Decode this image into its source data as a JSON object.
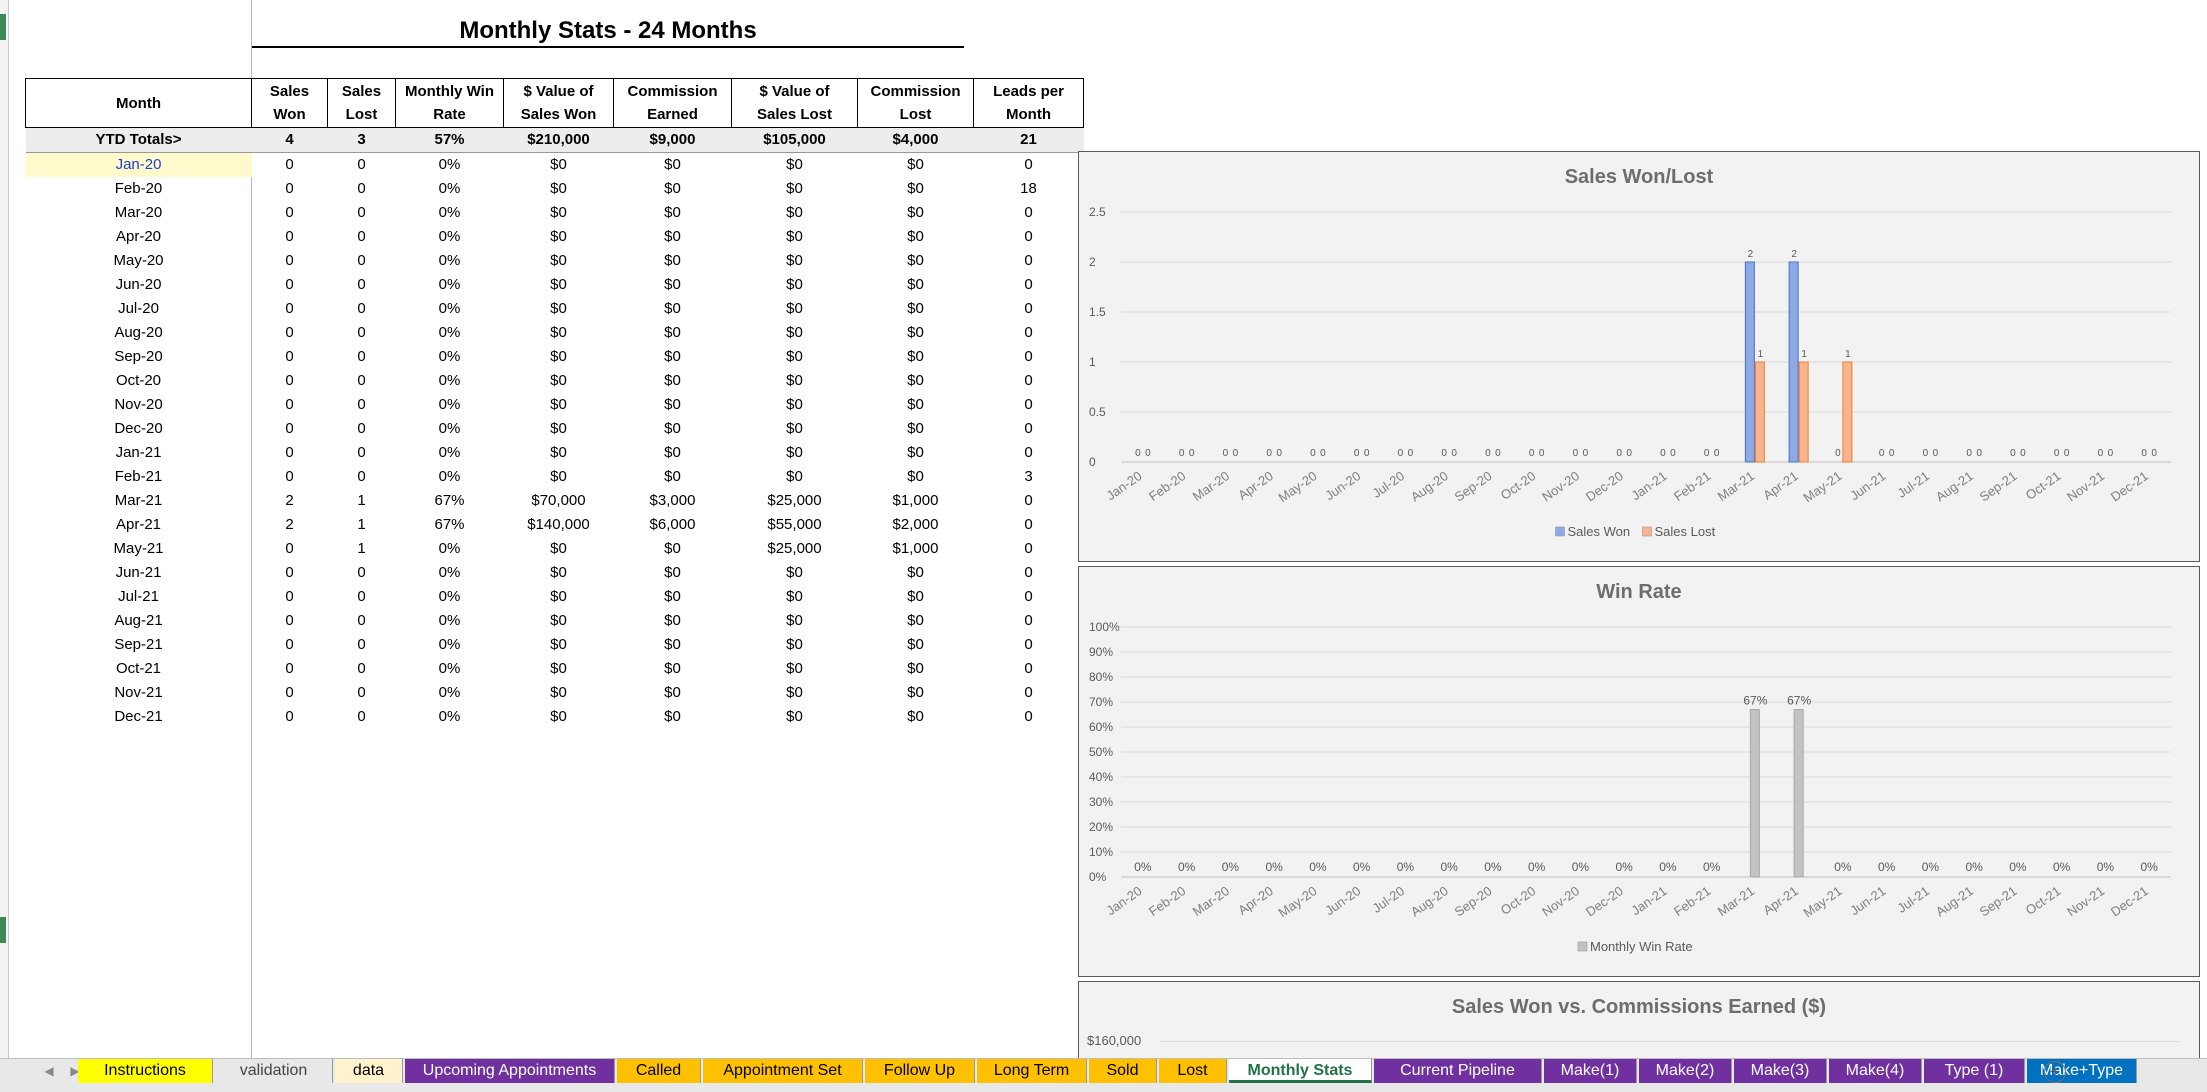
{
  "title": "Monthly Stats - 24 Months",
  "headers": [
    [
      "Month"
    ],
    [
      "Sales",
      "Won"
    ],
    [
      "Sales",
      "Lost"
    ],
    [
      "Monthly Win",
      "Rate"
    ],
    [
      "$ Value of",
      "Sales Won"
    ],
    [
      "Commission",
      "Earned"
    ],
    [
      "$ Value of",
      "Sales Lost"
    ],
    [
      "Commission",
      "Lost"
    ],
    [
      "Leads per",
      "Month"
    ]
  ],
  "totals": [
    "YTD Totals>",
    "4",
    "3",
    "57%",
    "$210,000",
    "$9,000",
    "$105,000",
    "$4,000",
    "21"
  ],
  "rows": [
    [
      "Jan-20",
      "0",
      "0",
      "0%",
      "$0",
      "$0",
      "$0",
      "$0",
      "0"
    ],
    [
      "Feb-20",
      "0",
      "0",
      "0%",
      "$0",
      "$0",
      "$0",
      "$0",
      "18"
    ],
    [
      "Mar-20",
      "0",
      "0",
      "0%",
      "$0",
      "$0",
      "$0",
      "$0",
      "0"
    ],
    [
      "Apr-20",
      "0",
      "0",
      "0%",
      "$0",
      "$0",
      "$0",
      "$0",
      "0"
    ],
    [
      "May-20",
      "0",
      "0",
      "0%",
      "$0",
      "$0",
      "$0",
      "$0",
      "0"
    ],
    [
      "Jun-20",
      "0",
      "0",
      "0%",
      "$0",
      "$0",
      "$0",
      "$0",
      "0"
    ],
    [
      "Jul-20",
      "0",
      "0",
      "0%",
      "$0",
      "$0",
      "$0",
      "$0",
      "0"
    ],
    [
      "Aug-20",
      "0",
      "0",
      "0%",
      "$0",
      "$0",
      "$0",
      "$0",
      "0"
    ],
    [
      "Sep-20",
      "0",
      "0",
      "0%",
      "$0",
      "$0",
      "$0",
      "$0",
      "0"
    ],
    [
      "Oct-20",
      "0",
      "0",
      "0%",
      "$0",
      "$0",
      "$0",
      "$0",
      "0"
    ],
    [
      "Nov-20",
      "0",
      "0",
      "0%",
      "$0",
      "$0",
      "$0",
      "$0",
      "0"
    ],
    [
      "Dec-20",
      "0",
      "0",
      "0%",
      "$0",
      "$0",
      "$0",
      "$0",
      "0"
    ],
    [
      "Jan-21",
      "0",
      "0",
      "0%",
      "$0",
      "$0",
      "$0",
      "$0",
      "0"
    ],
    [
      "Feb-21",
      "0",
      "0",
      "0%",
      "$0",
      "$0",
      "$0",
      "$0",
      "3"
    ],
    [
      "Mar-21",
      "2",
      "1",
      "67%",
      "$70,000",
      "$3,000",
      "$25,000",
      "$1,000",
      "0"
    ],
    [
      "Apr-21",
      "2",
      "1",
      "67%",
      "$140,000",
      "$6,000",
      "$55,000",
      "$2,000",
      "0"
    ],
    [
      "May-21",
      "0",
      "1",
      "0%",
      "$0",
      "$0",
      "$25,000",
      "$1,000",
      "0"
    ],
    [
      "Jun-21",
      "0",
      "0",
      "0%",
      "$0",
      "$0",
      "$0",
      "$0",
      "0"
    ],
    [
      "Jul-21",
      "0",
      "0",
      "0%",
      "$0",
      "$0",
      "$0",
      "$0",
      "0"
    ],
    [
      "Aug-21",
      "0",
      "0",
      "0%",
      "$0",
      "$0",
      "$0",
      "$0",
      "0"
    ],
    [
      "Sep-21",
      "0",
      "0",
      "0%",
      "$0",
      "$0",
      "$0",
      "$0",
      "0"
    ],
    [
      "Oct-21",
      "0",
      "0",
      "0%",
      "$0",
      "$0",
      "$0",
      "$0",
      "0"
    ],
    [
      "Nov-21",
      "0",
      "0",
      "0%",
      "$0",
      "$0",
      "$0",
      "$0",
      "0"
    ],
    [
      "Dec-21",
      "0",
      "0",
      "0%",
      "$0",
      "$0",
      "$0",
      "$0",
      "0"
    ]
  ],
  "chart_data": [
    {
      "type": "bar",
      "title": "Sales Won/Lost",
      "categories": [
        "Jan-20",
        "Feb-20",
        "Mar-20",
        "Apr-20",
        "May-20",
        "Jun-20",
        "Jul-20",
        "Aug-20",
        "Sep-20",
        "Oct-20",
        "Nov-20",
        "Dec-20",
        "Jan-21",
        "Feb-21",
        "Mar-21",
        "Apr-21",
        "May-21",
        "Jun-21",
        "Jul-21",
        "Aug-21",
        "Sep-21",
        "Oct-21",
        "Nov-21",
        "Dec-21"
      ],
      "series": [
        {
          "name": "Sales Won",
          "color": "#8ea9e6",
          "values": [
            0,
            0,
            0,
            0,
            0,
            0,
            0,
            0,
            0,
            0,
            0,
            0,
            0,
            0,
            2,
            2,
            0,
            0,
            0,
            0,
            0,
            0,
            0,
            0
          ]
        },
        {
          "name": "Sales Lost",
          "color": "#f7b58e",
          "values": [
            0,
            0,
            0,
            0,
            0,
            0,
            0,
            0,
            0,
            0,
            0,
            0,
            0,
            0,
            1,
            1,
            1,
            0,
            0,
            0,
            0,
            0,
            0,
            0
          ]
        }
      ],
      "ylim": [
        0,
        2.5
      ],
      "yticks": [
        "0",
        "0.5",
        "1",
        "1.5",
        "2",
        "2.5"
      ],
      "grid": true,
      "legend": "bottom",
      "data_labels": true
    },
    {
      "type": "bar",
      "title": "Win Rate",
      "categories": [
        "Jan-20",
        "Feb-20",
        "Mar-20",
        "Apr-20",
        "May-20",
        "Jun-20",
        "Jul-20",
        "Aug-20",
        "Sep-20",
        "Oct-20",
        "Nov-20",
        "Dec-20",
        "Jan-21",
        "Feb-21",
        "Mar-21",
        "Apr-21",
        "May-21",
        "Jun-21",
        "Jul-21",
        "Aug-21",
        "Sep-21",
        "Oct-21",
        "Nov-21",
        "Dec-21"
      ],
      "series": [
        {
          "name": "Monthly Win Rate",
          "color": "#c3c3c3",
          "values": [
            0,
            0,
            0,
            0,
            0,
            0,
            0,
            0,
            0,
            0,
            0,
            0,
            0,
            0,
            67,
            67,
            0,
            0,
            0,
            0,
            0,
            0,
            0,
            0
          ]
        }
      ],
      "ylim": [
        0,
        100
      ],
      "yticks": [
        "0%",
        "10%",
        "20%",
        "30%",
        "40%",
        "50%",
        "60%",
        "70%",
        "80%",
        "90%",
        "100%"
      ],
      "value_format": "percent",
      "grid": true,
      "legend": "bottom",
      "data_labels": true
    },
    {
      "type": "bar",
      "title": "Sales Won vs. Commissions Earned ($)",
      "yticks_visible": [
        "$160,000"
      ]
    }
  ],
  "tabs": [
    {
      "label": "Instructions",
      "bg": "#ffff00",
      "fg": "#000000"
    },
    {
      "label": "validation",
      "bg": "#e8e8e8",
      "fg": "#444444"
    },
    {
      "label": "data",
      "bg": "#fff2cc",
      "fg": "#000000"
    },
    {
      "label": "Upcoming Appointments",
      "bg": "#7030a0",
      "fg": "#ffffff"
    },
    {
      "label": "Called",
      "bg": "#ffc000",
      "fg": "#000000"
    },
    {
      "label": "Appointment Set",
      "bg": "#ffc000",
      "fg": "#000000"
    },
    {
      "label": "Follow Up",
      "bg": "#ffc000",
      "fg": "#000000"
    },
    {
      "label": "Long Term",
      "bg": "#ffc000",
      "fg": "#000000"
    },
    {
      "label": "Sold",
      "bg": "#ffc000",
      "fg": "#000000"
    },
    {
      "label": "Lost",
      "bg": "#ffc000",
      "fg": "#000000"
    },
    {
      "label": "Monthly Stats",
      "bg": "#ffffff",
      "fg": "#217346"
    },
    {
      "label": "Current Pipeline",
      "bg": "#7030a0",
      "fg": "#ffffff"
    },
    {
      "label": "Make(1)",
      "bg": "#7030a0",
      "fg": "#ffffff"
    },
    {
      "label": "Make(2)",
      "bg": "#7030a0",
      "fg": "#ffffff"
    },
    {
      "label": "Make(3)",
      "bg": "#7030a0",
      "fg": "#ffffff"
    },
    {
      "label": "Make(4)",
      "bg": "#7030a0",
      "fg": "#ffffff"
    },
    {
      "label": "Type (1)",
      "bg": "#7030a0",
      "fg": "#ffffff"
    },
    {
      "label": "Make+Type",
      "bg": "#0070c0",
      "fg": "#ffffff"
    }
  ],
  "icons": {
    "add_sheet": "plus-circle-icon",
    "nav_prev": "triangle-left-icon",
    "nav_next": "triangle-right-icon"
  }
}
